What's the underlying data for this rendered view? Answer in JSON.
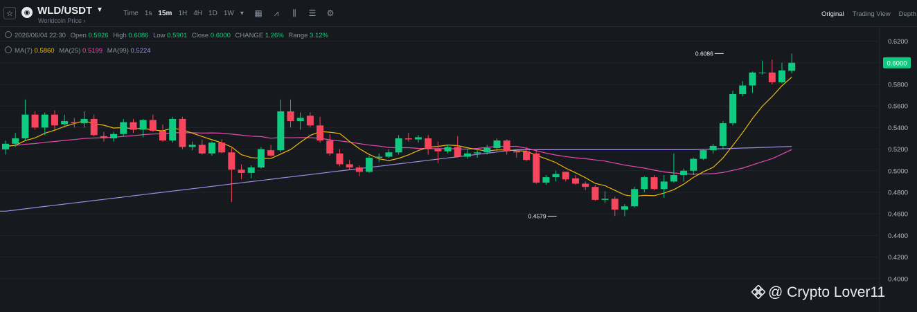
{
  "header": {
    "pair": "WLD/USDT",
    "subtitle": "Worldcoin Price",
    "intervals": [
      "Time",
      "1s",
      "15m",
      "1H",
      "4H",
      "1D",
      "1W"
    ],
    "active_interval": "15m",
    "views": [
      "Original",
      "Trading View",
      "Depth"
    ],
    "active_view": "Original"
  },
  "ohlc": {
    "datetime": "2026/06/04 22:30",
    "open_label": "Open",
    "open": "0.5926",
    "high_label": "High",
    "high": "0.6086",
    "low_label": "Low",
    "low": "0.5901",
    "close_label": "Close",
    "close": "0.6000",
    "change_label": "CHANGE",
    "change": "1.26%",
    "range_label": "Range",
    "range": "3.12%"
  },
  "ma": {
    "ma7_label": "MA(7)",
    "ma7": "0.5860",
    "ma25_label": "MA(25)",
    "ma25": "0.5199",
    "ma99_label": "MA(99)",
    "ma99": "0.5224"
  },
  "colors": {
    "up": "#0ecb81",
    "down": "#f6465d",
    "ma7": "#f0b90b",
    "ma25": "#e84ab0",
    "ma99": "#9f8bdf",
    "grid": "#20252b"
  },
  "watermark": "@ Crypto Lover11",
  "chart_data": {
    "type": "candlestick",
    "y_axis_ticks": [
      "0.6200",
      "0.6000",
      "0.5800",
      "0.5600",
      "0.5400",
      "0.5200",
      "0.5000",
      "0.4800",
      "0.4600",
      "0.4400",
      "0.4200",
      "0.4000"
    ],
    "ylim": [
      0.396,
      0.63
    ],
    "last_price": "0.6000",
    "annotations": [
      {
        "label": "0.6086",
        "value": 0.6086,
        "index": 73
      },
      {
        "label": "0.4579",
        "value": 0.4579,
        "index": 56
      }
    ],
    "candles": [
      {
        "o": 0.5198,
        "h": 0.528,
        "l": 0.515,
        "c": 0.525
      },
      {
        "o": 0.525,
        "h": 0.535,
        "l": 0.522,
        "c": 0.53
      },
      {
        "o": 0.53,
        "h": 0.566,
        "l": 0.528,
        "c": 0.552
      },
      {
        "o": 0.552,
        "h": 0.555,
        "l": 0.538,
        "c": 0.54
      },
      {
        "o": 0.54,
        "h": 0.554,
        "l": 0.533,
        "c": 0.552
      },
      {
        "o": 0.552,
        "h": 0.556,
        "l": 0.538,
        "c": 0.542
      },
      {
        "o": 0.543,
        "h": 0.552,
        "l": 0.54,
        "c": 0.546
      },
      {
        "o": 0.545,
        "h": 0.549,
        "l": 0.54,
        "c": 0.544
      },
      {
        "o": 0.544,
        "h": 0.555,
        "l": 0.54,
        "c": 0.548
      },
      {
        "o": 0.548,
        "h": 0.552,
        "l": 0.532,
        "c": 0.533
      },
      {
        "o": 0.532,
        "h": 0.536,
        "l": 0.527,
        "c": 0.53
      },
      {
        "o": 0.53,
        "h": 0.536,
        "l": 0.527,
        "c": 0.534
      },
      {
        "o": 0.534,
        "h": 0.548,
        "l": 0.532,
        "c": 0.545
      },
      {
        "o": 0.545,
        "h": 0.548,
        "l": 0.535,
        "c": 0.538
      },
      {
        "o": 0.538,
        "h": 0.548,
        "l": 0.531,
        "c": 0.547
      },
      {
        "o": 0.547,
        "h": 0.552,
        "l": 0.536,
        "c": 0.537
      },
      {
        "o": 0.537,
        "h": 0.543,
        "l": 0.527,
        "c": 0.528
      },
      {
        "o": 0.528,
        "h": 0.55,
        "l": 0.526,
        "c": 0.548
      },
      {
        "o": 0.548,
        "h": 0.55,
        "l": 0.52,
        "c": 0.522
      },
      {
        "o": 0.522,
        "h": 0.527,
        "l": 0.519,
        "c": 0.524
      },
      {
        "o": 0.524,
        "h": 0.529,
        "l": 0.515,
        "c": 0.516
      },
      {
        "o": 0.516,
        "h": 0.527,
        "l": 0.514,
        "c": 0.526
      },
      {
        "o": 0.526,
        "h": 0.529,
        "l": 0.516,
        "c": 0.517
      },
      {
        "o": 0.517,
        "h": 0.521,
        "l": 0.471,
        "c": 0.501
      },
      {
        "o": 0.501,
        "h": 0.506,
        "l": 0.492,
        "c": 0.498
      },
      {
        "o": 0.498,
        "h": 0.505,
        "l": 0.493,
        "c": 0.503
      },
      {
        "o": 0.503,
        "h": 0.522,
        "l": 0.502,
        "c": 0.52
      },
      {
        "o": 0.519,
        "h": 0.524,
        "l": 0.513,
        "c": 0.514
      },
      {
        "o": 0.519,
        "h": 0.566,
        "l": 0.517,
        "c": 0.555
      },
      {
        "o": 0.555,
        "h": 0.566,
        "l": 0.54,
        "c": 0.546
      },
      {
        "o": 0.546,
        "h": 0.554,
        "l": 0.538,
        "c": 0.549
      },
      {
        "o": 0.551,
        "h": 0.554,
        "l": 0.54,
        "c": 0.542
      },
      {
        "o": 0.542,
        "h": 0.55,
        "l": 0.526,
        "c": 0.528
      },
      {
        "o": 0.528,
        "h": 0.534,
        "l": 0.514,
        "c": 0.516
      },
      {
        "o": 0.516,
        "h": 0.52,
        "l": 0.504,
        "c": 0.506
      },
      {
        "o": 0.506,
        "h": 0.51,
        "l": 0.501,
        "c": 0.503
      },
      {
        "o": 0.503,
        "h": 0.505,
        "l": 0.495,
        "c": 0.499
      },
      {
        "o": 0.499,
        "h": 0.514,
        "l": 0.498,
        "c": 0.512
      },
      {
        "o": 0.512,
        "h": 0.516,
        "l": 0.508,
        "c": 0.513
      },
      {
        "o": 0.513,
        "h": 0.52,
        "l": 0.512,
        "c": 0.517
      },
      {
        "o": 0.517,
        "h": 0.533,
        "l": 0.515,
        "c": 0.53
      },
      {
        "o": 0.53,
        "h": 0.535,
        "l": 0.527,
        "c": 0.529
      },
      {
        "o": 0.529,
        "h": 0.533,
        "l": 0.526,
        "c": 0.531
      },
      {
        "o": 0.53,
        "h": 0.533,
        "l": 0.515,
        "c": 0.52
      },
      {
        "o": 0.52,
        "h": 0.527,
        "l": 0.507,
        "c": 0.518
      },
      {
        "o": 0.518,
        "h": 0.524,
        "l": 0.516,
        "c": 0.522
      },
      {
        "o": 0.522,
        "h": 0.532,
        "l": 0.512,
        "c": 0.513
      },
      {
        "o": 0.513,
        "h": 0.52,
        "l": 0.511,
        "c": 0.516
      },
      {
        "o": 0.516,
        "h": 0.52,
        "l": 0.512,
        "c": 0.517
      },
      {
        "o": 0.517,
        "h": 0.524,
        "l": 0.515,
        "c": 0.521
      },
      {
        "o": 0.521,
        "h": 0.53,
        "l": 0.518,
        "c": 0.528
      },
      {
        "o": 0.528,
        "h": 0.529,
        "l": 0.515,
        "c": 0.518
      },
      {
        "o": 0.518,
        "h": 0.52,
        "l": 0.512,
        "c": 0.517
      },
      {
        "o": 0.518,
        "h": 0.522,
        "l": 0.509,
        "c": 0.51
      },
      {
        "o": 0.516,
        "h": 0.52,
        "l": 0.488,
        "c": 0.489
      },
      {
        "o": 0.489,
        "h": 0.496,
        "l": 0.487,
        "c": 0.494
      },
      {
        "o": 0.494,
        "h": 0.5,
        "l": 0.49,
        "c": 0.497
      },
      {
        "o": 0.499,
        "h": 0.499,
        "l": 0.49,
        "c": 0.492
      },
      {
        "o": 0.493,
        "h": 0.496,
        "l": 0.487,
        "c": 0.488
      },
      {
        "o": 0.488,
        "h": 0.49,
        "l": 0.482,
        "c": 0.485
      },
      {
        "o": 0.485,
        "h": 0.487,
        "l": 0.472,
        "c": 0.473
      },
      {
        "o": 0.473,
        "h": 0.481,
        "l": 0.47,
        "c": 0.474
      },
      {
        "o": 0.474,
        "h": 0.476,
        "l": 0.458,
        "c": 0.464
      },
      {
        "o": 0.464,
        "h": 0.469,
        "l": 0.4579,
        "c": 0.467
      },
      {
        "o": 0.467,
        "h": 0.485,
        "l": 0.466,
        "c": 0.483
      },
      {
        "o": 0.483,
        "h": 0.495,
        "l": 0.48,
        "c": 0.494
      },
      {
        "o": 0.494,
        "h": 0.496,
        "l": 0.482,
        "c": 0.483
      },
      {
        "o": 0.483,
        "h": 0.496,
        "l": 0.475,
        "c": 0.49
      },
      {
        "o": 0.49,
        "h": 0.516,
        "l": 0.489,
        "c": 0.496
      },
      {
        "o": 0.496,
        "h": 0.502,
        "l": 0.49,
        "c": 0.5
      },
      {
        "o": 0.5,
        "h": 0.512,
        "l": 0.496,
        "c": 0.511
      },
      {
        "o": 0.511,
        "h": 0.52,
        "l": 0.51,
        "c": 0.519
      },
      {
        "o": 0.519,
        "h": 0.525,
        "l": 0.516,
        "c": 0.523
      },
      {
        "o": 0.523,
        "h": 0.546,
        "l": 0.52,
        "c": 0.544
      },
      {
        "o": 0.544,
        "h": 0.574,
        "l": 0.542,
        "c": 0.571
      },
      {
        "o": 0.571,
        "h": 0.583,
        "l": 0.569,
        "c": 0.579
      },
      {
        "o": 0.579,
        "h": 0.592,
        "l": 0.572,
        "c": 0.591
      },
      {
        "o": 0.591,
        "h": 0.602,
        "l": 0.589,
        "c": 0.591
      },
      {
        "o": 0.591,
        "h": 0.603,
        "l": 0.58,
        "c": 0.582
      },
      {
        "o": 0.582,
        "h": 0.6,
        "l": 0.581,
        "c": 0.593
      },
      {
        "o": 0.5926,
        "h": 0.6086,
        "l": 0.5901,
        "c": 0.6
      }
    ]
  }
}
